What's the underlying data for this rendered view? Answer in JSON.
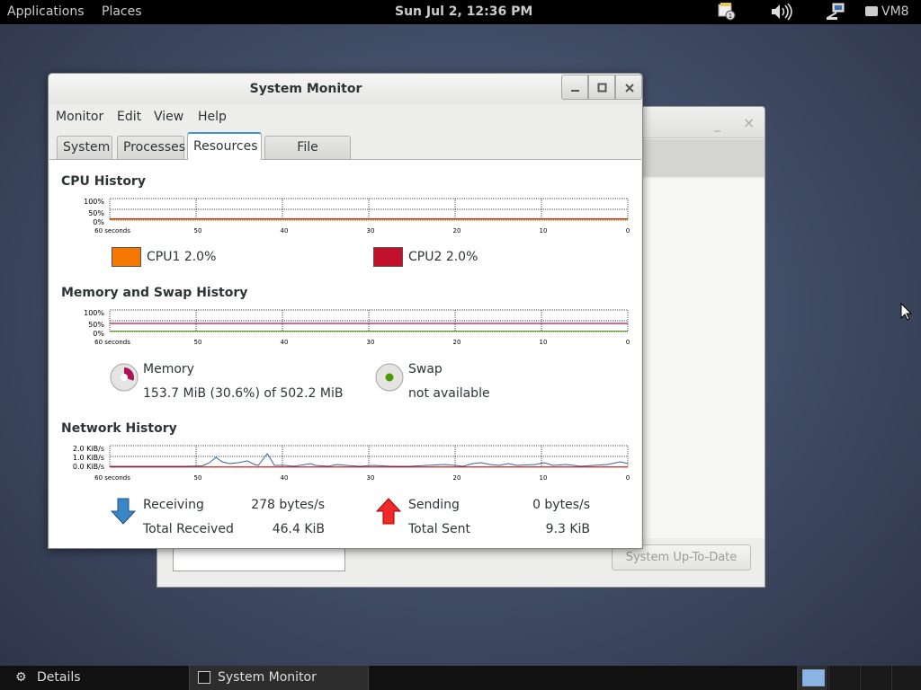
{
  "top_panel": {
    "applications": "Applications",
    "places": "Places",
    "clock": "Sun Jul  2, 12:36 PM",
    "user": "VM8"
  },
  "window": {
    "title": "System Monitor",
    "menu": [
      "Monitor",
      "Edit",
      "View",
      "Help"
    ],
    "tabs": [
      "System",
      "Processes",
      "Resources",
      "File Systems"
    ],
    "active_tab": "Resources"
  },
  "cpu": {
    "title": "CPU History",
    "y_ticks": [
      "100%",
      "50%",
      "0%"
    ],
    "x_ticks": [
      "60 seconds",
      "50",
      "40",
      "30",
      "20",
      "10",
      "0"
    ],
    "cpu1_label": "CPU1  2.0%",
    "cpu2_label": "CPU2  2.0%",
    "cpu1_color": "#f57900",
    "cpu2_color": "#c0102c"
  },
  "memory": {
    "title": "Memory and Swap History",
    "y_ticks": [
      "100%",
      "50%",
      "0%"
    ],
    "x_ticks": [
      "60 seconds",
      "50",
      "40",
      "30",
      "20",
      "10",
      "0"
    ],
    "memory_label": "Memory",
    "memory_value": "153.7 MiB (30.6%) of 502.2 MiB",
    "memory_fraction": 0.306,
    "memory_color": "#ad1457",
    "swap_label": "Swap",
    "swap_value": "not available",
    "swap_color": "#4e9a06"
  },
  "network": {
    "title": "Network History",
    "y_ticks": [
      "2.0 KiB/s",
      "1.0 KiB/s",
      "0.0 KiB/s"
    ],
    "x_ticks": [
      "60 seconds",
      "50",
      "40",
      "30",
      "20",
      "10",
      "0"
    ],
    "receiving_label": "Receiving",
    "receiving_value": "278 bytes/s",
    "total_received_label": "Total Received",
    "total_received_value": "46.4 KiB",
    "sending_label": "Sending",
    "sending_value": "0 bytes/s",
    "total_sent_label": "Total Sent",
    "total_sent_value": "9.3 KiB",
    "receive_color": "#3465a4",
    "send_color": "#cc0000"
  },
  "background_window": {
    "button": "System Up-To-Date"
  },
  "bottom_panel": {
    "details": "Details",
    "task": "System Monitor"
  }
}
